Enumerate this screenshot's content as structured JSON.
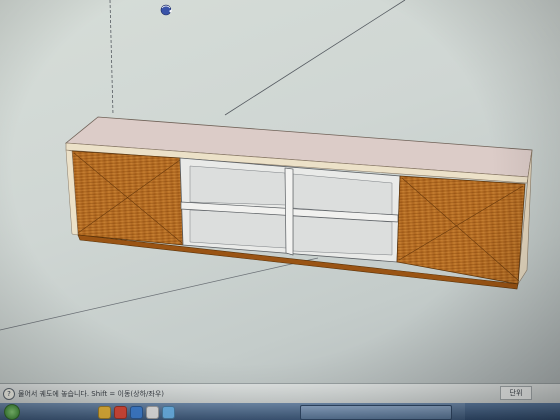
{
  "status_bar": {
    "hint_icon": "?",
    "hint_text": "물어서 궤도에 놓습니다. Shift = 이동(상하/좌우)",
    "units_label": "단위"
  },
  "icons": {
    "cursor": "orbit-cursor-icon",
    "taskbar_buttons": [
      "start-orb-icon",
      "quicklaunch-icon-1",
      "quicklaunch-icon-2",
      "quicklaunch-icon-3",
      "quicklaunch-icon-4",
      "quicklaunch-icon-5"
    ]
  },
  "colors": {
    "viewport_bg": "#d3dad6",
    "panel_top": "#dcccc8",
    "panel_front_edge": "#ece1c8",
    "wood_dark": "#a55d17",
    "wood_light": "#cc8433",
    "shelf_interior": "#e9eae8",
    "axis_line": "#555a60",
    "taskbar": "#4b6688"
  }
}
